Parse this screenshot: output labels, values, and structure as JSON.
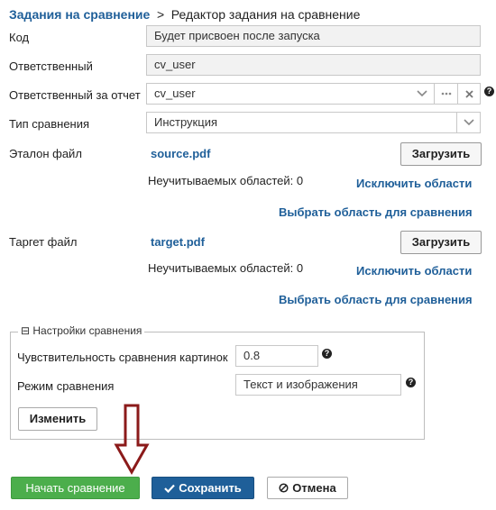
{
  "breadcrumb": {
    "parent": "Задания на сравнение",
    "separator": ">",
    "current": "Редактор задания на сравнение"
  },
  "form": {
    "code": {
      "label": "Код",
      "value": "Будет присвоен после запуска"
    },
    "owner": {
      "label": "Ответственный",
      "value": "cv_user"
    },
    "report_owner": {
      "label": "Ответственный за отчет",
      "value": "cv_user",
      "help": "?"
    },
    "compare_type": {
      "label": "Тип сравнения",
      "value": "Инструкция"
    },
    "reference": {
      "label": "Эталон файл",
      "file": "source.pdf",
      "upload": "Загрузить",
      "ignored": "Неучитываемых областей: 0",
      "exclude": "Исключить области",
      "select_area": "Выбрать область для сравнения"
    },
    "target": {
      "label": "Таргет файл",
      "file": "target.pdf",
      "upload": "Загрузить",
      "ignored": "Неучитываемых областей: 0",
      "exclude": "Исключить области",
      "select_area": "Выбрать область для сравнения"
    }
  },
  "settings": {
    "legend": "⊟ Настройки сравнения",
    "sensitivity": {
      "label": "Чувствительность сравнения картинок",
      "value": "0.8",
      "help": "?"
    },
    "mode": {
      "label": "Режим сравнения",
      "value": "Текст и изображения",
      "help": "?"
    },
    "change_button": "Изменить"
  },
  "actions": {
    "start": "Начать сравнение",
    "save": "Сохранить",
    "save_icon": "check-icon",
    "cancel": "Отмена",
    "cancel_icon": "ban-icon"
  },
  "annotation": {
    "arrow_color": "#8b1a1a"
  }
}
